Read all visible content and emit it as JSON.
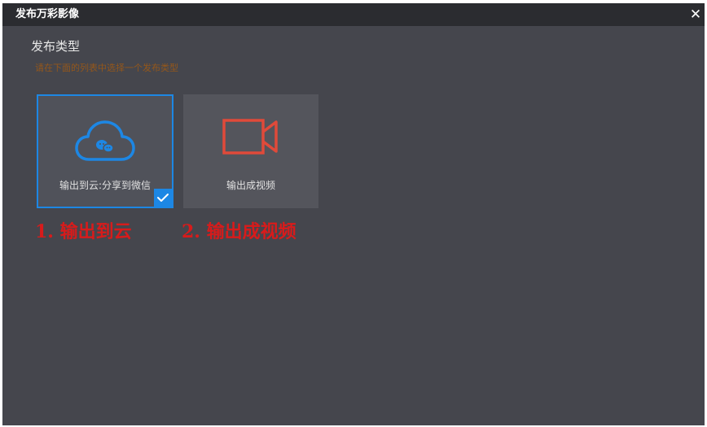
{
  "window": {
    "title": "发布万彩影像",
    "close_symbol": "✕"
  },
  "section": {
    "title": "发布类型",
    "hint": "请在下面的列表中选择一个发布类型"
  },
  "options": [
    {
      "label": "输出到云:分享到微信",
      "icon": "cloud-wechat-icon",
      "selected": true,
      "accent_color": "#1d87e4"
    },
    {
      "label": "输出成视频",
      "icon": "video-camera-icon",
      "selected": false,
      "accent_color": "#e04a3a"
    }
  ],
  "annotations": [
    "1. 输出到云",
    "2. 输出成视频"
  ],
  "colors": {
    "dialog_bg": "#45464d",
    "titlebar_bg": "#2b2c30",
    "hint": "#a25a12",
    "annotation": "#d81b1b",
    "selection": "#1d87e4"
  }
}
